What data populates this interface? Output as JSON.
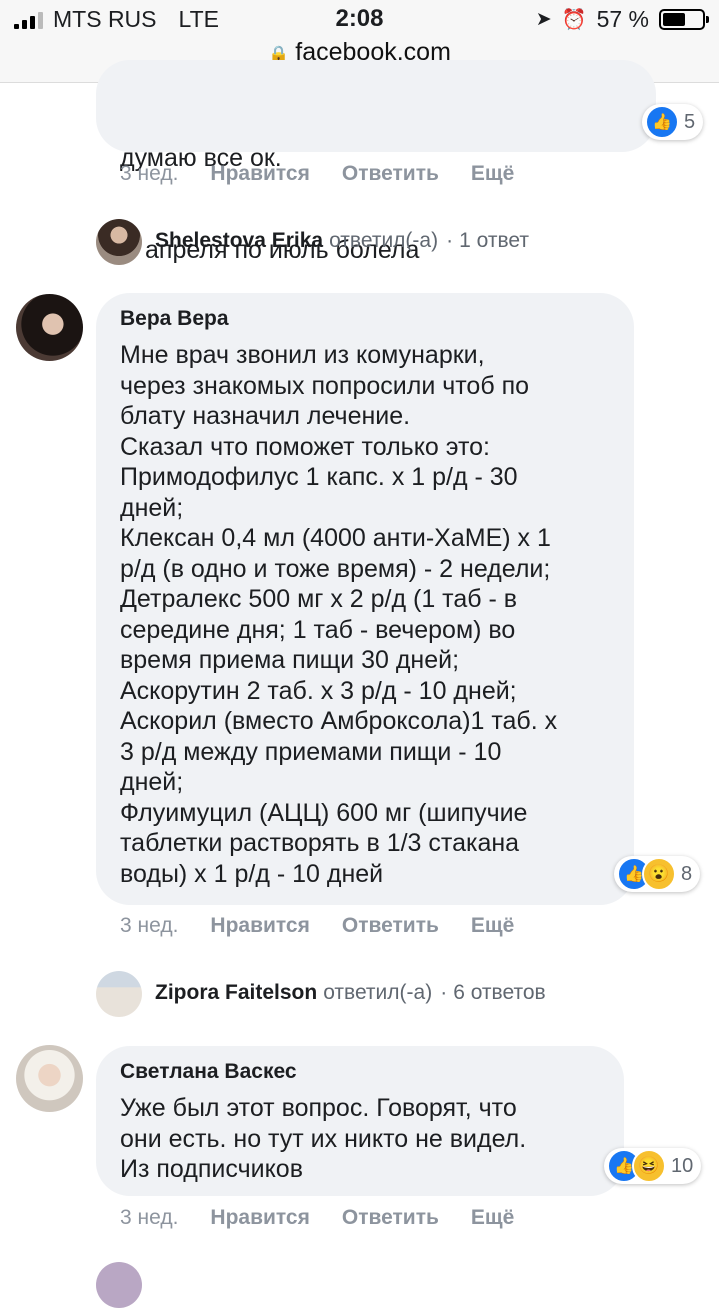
{
  "status": {
    "carrier": "MTS RUS",
    "network": "LTE",
    "time": "2:08",
    "battery": "57 %",
    "battery_level": 0.57,
    "url": "facebook.com"
  },
  "comments": [
    {
      "author": "",
      "text_lines": [
        "думаю все ок.",
        "С апреля по июль болела"
      ],
      "time": "3 нед.",
      "reaction_count": "5",
      "reactions": [
        "like"
      ]
    },
    {
      "author": "Вера Вера",
      "text": "Мне врач звонил из комунарки,\nчерез знакомых попросили чтоб по\nблату назначил лечение.\nСказал что поможет только это:\nПримодофилус 1 капс. х 1 р/д - 30\nдней;\nКлексан 0,4 мл (4000 анти-ХаМЕ) х 1\nр/д (в одно и тоже время) - 2 недели;\nДетралекс 500 мг х 2 р/д (1 таб - в\nсередине дня; 1 таб - вечером) во\nвремя приема пищи 30 дней;\nАскорутин 2 таб. х 3 р/д - 10 дней;\nАскорил (вместо Амброксола)1 таб. х\n3 р/д между приемами пищи - 10\nдней;\nФлуимуцил (АЦЦ) 600 мг (шипучие\nтаблетки растворять в 1/3 стакана\nводы) х 1 р/д - 10 дней",
      "time": "3 нед.",
      "reaction_count": "8",
      "reactions": [
        "like",
        "wow"
      ]
    },
    {
      "author": "Светлана Васкес",
      "text": "Уже был этот вопрос. Говорят, что\nони есть. но тут их никто не видел.\nИз подписчиков",
      "time": "3 нед.",
      "reaction_count": "10",
      "reactions": [
        "like",
        "haha"
      ]
    }
  ],
  "actions": {
    "like": "Нравится",
    "reply": "Ответить",
    "more": "Ещё"
  },
  "reply_threads": [
    {
      "name": "Shelestova Erika",
      "verb": "ответил(-а)",
      "sep": "·",
      "count": "1 ответ"
    },
    {
      "name": "Zipora Faitelson",
      "verb": "ответил(-а)",
      "sep": "·",
      "count": "6 ответов"
    }
  ]
}
